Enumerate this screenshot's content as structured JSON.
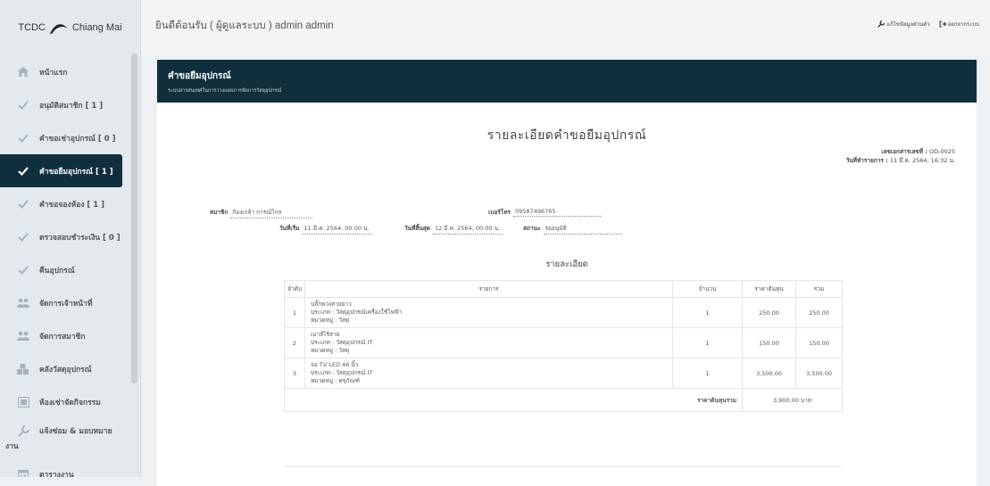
{
  "sidebar": {
    "logo_text": "TCDC",
    "logo_city": "Chiang Mai",
    "items": [
      {
        "label": "หน้าแรก",
        "icon": "home-icon"
      },
      {
        "label": "อนุมัติสมาชิก [ 1 ]",
        "icon": "check-icon"
      },
      {
        "label": "คำขอเช่าอุปกรณ์ [ 0 ]",
        "icon": "check-icon"
      },
      {
        "label": "คำขอยืมอุปกรณ์ [ 1 ]",
        "icon": "check-icon"
      },
      {
        "label": "คำขอจองห้อง [ 1 ]",
        "icon": "check-icon"
      },
      {
        "label": "ตรวจสอบชำระเงิน [ 0 ]",
        "icon": "check-icon"
      },
      {
        "label": "คืนอุปกรณ์",
        "icon": "check-icon"
      },
      {
        "label": "จัดการเจ้าหน้าที่",
        "icon": "users-icon"
      },
      {
        "label": "จัดการสมาชิก",
        "icon": "users-icon"
      },
      {
        "label": "คลังวัสดุอุปกรณ์",
        "icon": "boxes-icon"
      },
      {
        "label": "ห้องเช่าจัดกิจกรรม",
        "icon": "room-icon"
      },
      {
        "label": "แจ้งซ่อม & มอบหมาย",
        "label2": "งาน",
        "icon": "wrench-icon"
      },
      {
        "label": "ตารางงาน",
        "icon": "calendar-icon"
      }
    ]
  },
  "topbar": {
    "welcome": "ยินดีต้อนรับ ( ผู้ดูแลระบบ ) admin admin",
    "edit_profile": "แก้ไขข้อมูลส่วนตัว",
    "logout": "ออกจากระบบ"
  },
  "header": {
    "title": "คำขอยืมอุปกรณ์",
    "subtitle": "ระบบสารสนเทศในการวางแผนการจัดการวัสดุอุปกรณ์"
  },
  "document": {
    "title": "รายละเอียดคำขอยืมอุปกรณ์",
    "doc_no_label": "เลขเอกสารเลขที่ :",
    "doc_no": "OD-0025",
    "date_label": "วันที่ทำรายการ :",
    "date": "11 มี.ค. 2564, 16:32 น.",
    "member_label": "สมาชิก",
    "member": "ก้องเกล้า การณ์ไกล",
    "phone_label": "เบอร์โทร",
    "phone": "09587496765",
    "start_label": "วันที่เริ่ม",
    "start": "11 มี.ค. 2564, 00:00 น.",
    "end_label": "วันที่สิ้นสุด",
    "end": "12 มี.ค. 2564, 00:00 น.",
    "status_label": "สถานะ",
    "status": "รออนุมัติ",
    "section_title": "รายละเอียด"
  },
  "table": {
    "headers": [
      "ลำดับ",
      "รายการ",
      "จำนวน",
      "ราคาต้นทุน",
      "รวม"
    ],
    "rows": [
      {
        "no": "1",
        "name": "ปลั๊กพ่วงสายยาว",
        "type": "ประเภท : วัสดุอุปกรณ์เครื่องใช้ไฟฟ้า",
        "cat": "หมวดหมู่ : วัสดุ",
        "qty": "1",
        "price": "250.00",
        "total": "250.00"
      },
      {
        "no": "2",
        "name": "เมาส์ไร้สาย",
        "type": "ประเภท : วัสดุอุปกรณ์ IT",
        "cat": "หมวดหมู่ : วัสดุ",
        "qty": "1",
        "price": "150.00",
        "total": "150.00"
      },
      {
        "no": "3",
        "name": "จอ TV LED 46 นิ้ว",
        "type": "ประเภท : วัสดุอุปกรณ์ IT",
        "cat": "หมวดหมู่ : ครุภัณฑ์",
        "qty": "1",
        "price": "3,500.00",
        "total": "3,500.00"
      }
    ],
    "total_label": "ราคาต้นทุนรวม",
    "total_value": "3,900.00 บาท"
  }
}
